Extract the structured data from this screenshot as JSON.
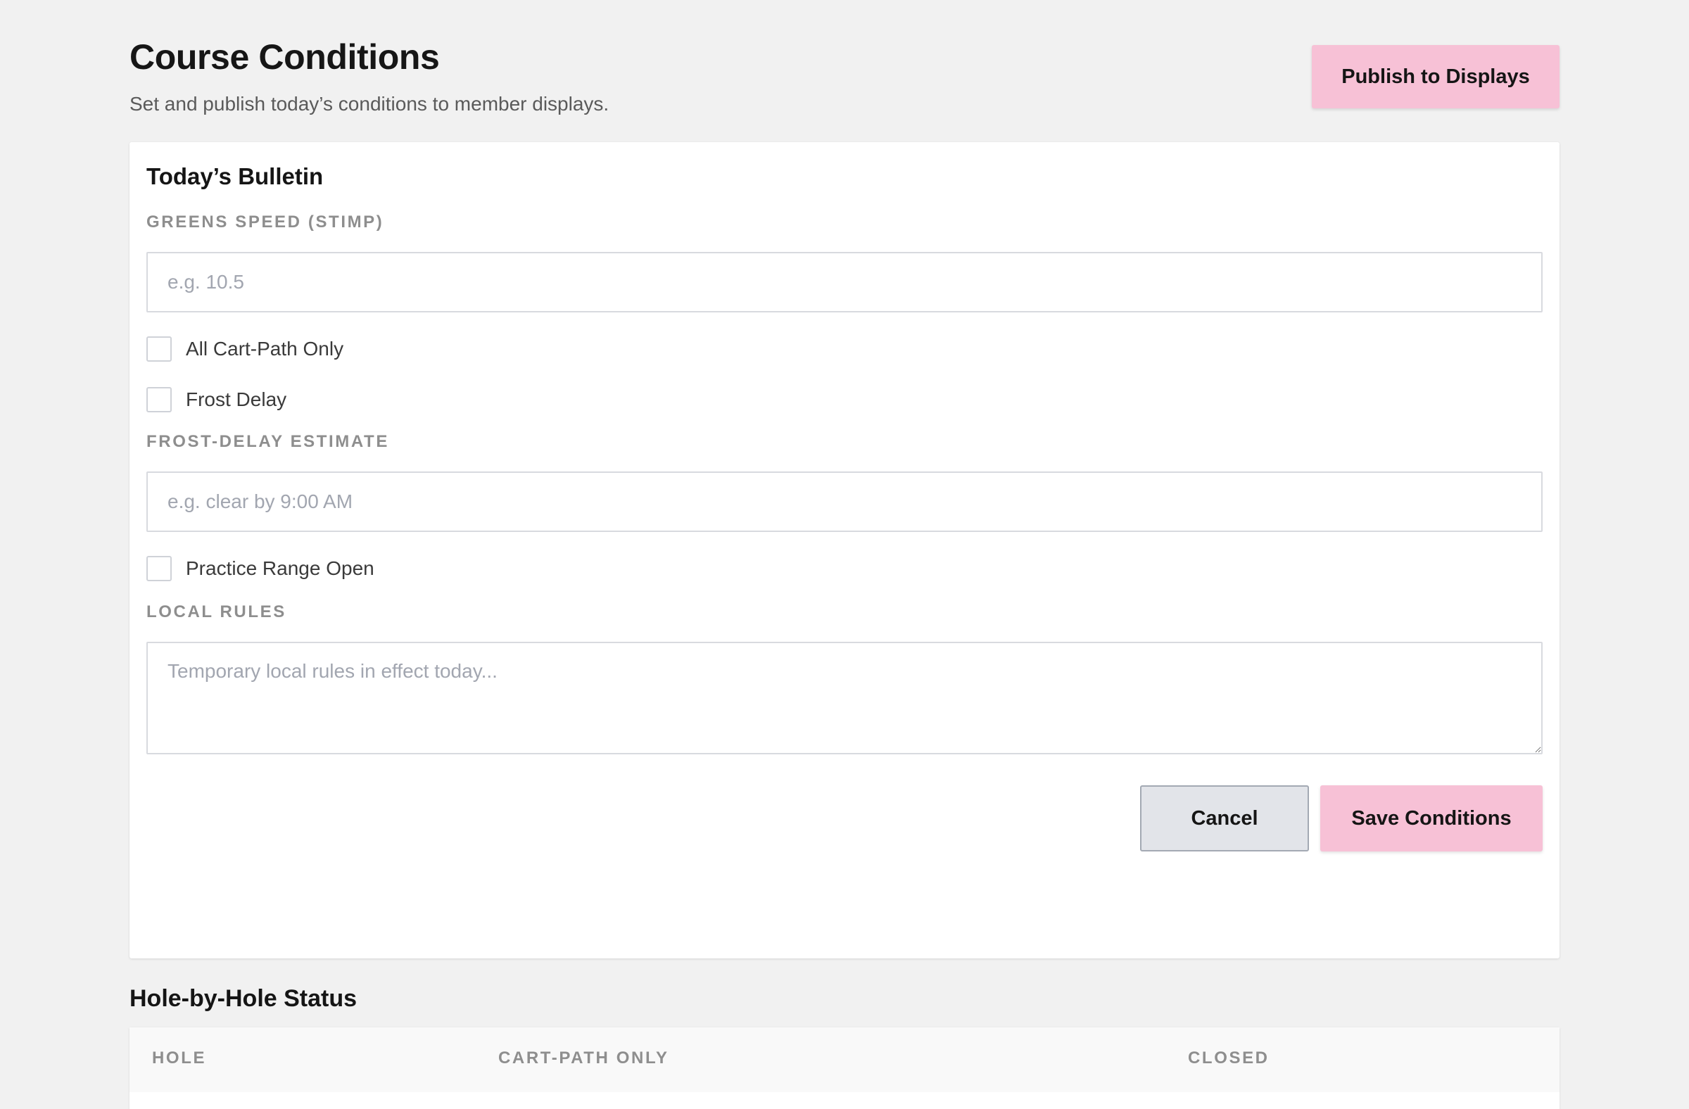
{
  "header": {
    "title": "Course Conditions",
    "subtitle": "Set and publish today’s conditions to member displays.",
    "publish_label": "Publish to Displays"
  },
  "bulletin": {
    "title": "Today’s Bulletin",
    "greens_speed": {
      "label": "GREENS SPEED (STIMP)",
      "value": "",
      "placeholder": "e.g. 10.5"
    },
    "checkboxes": {
      "cart_path": {
        "label": "All Cart-Path Only",
        "checked": false
      },
      "frost_delay": {
        "label": "Frost Delay",
        "checked": false
      },
      "practice_range": {
        "label": "Practice Range Open",
        "checked": false
      }
    },
    "frost_estimate": {
      "label": "FROST-DELAY ESTIMATE",
      "value": "",
      "placeholder": "e.g. clear by 9:00 AM"
    },
    "local_rules": {
      "label": "LOCAL RULES",
      "value": "",
      "placeholder": "Temporary local rules in effect today..."
    },
    "cancel_label": "Cancel",
    "save_label": "Save Conditions"
  },
  "holes": {
    "title": "Hole-by-Hole Status",
    "columns": [
      "HOLE",
      "CART-PATH ONLY",
      "CLOSED"
    ]
  },
  "colors": {
    "accent": "#f7c1d6",
    "background": "#f1f1f1",
    "secondary_button": "#e2e4e9"
  }
}
